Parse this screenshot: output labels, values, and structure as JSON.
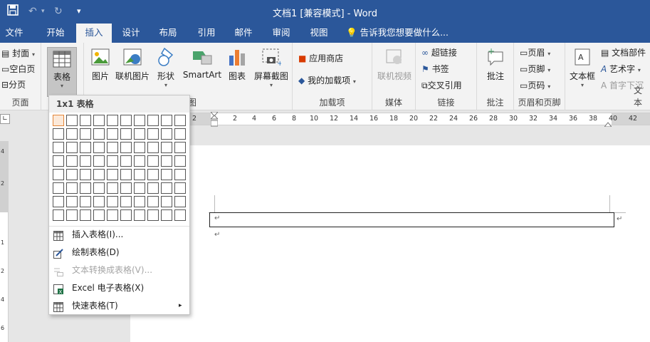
{
  "window": {
    "title": "文档1 [兼容模式] - Word"
  },
  "qat": {
    "save": "save-icon",
    "undo": "↶",
    "redo": "↻",
    "customize": "▾"
  },
  "tabs": [
    {
      "label": "文件"
    },
    {
      "label": "开始"
    },
    {
      "label": "插入",
      "active": true
    },
    {
      "label": "设计"
    },
    {
      "label": "布局"
    },
    {
      "label": "引用"
    },
    {
      "label": "邮件"
    },
    {
      "label": "审阅"
    },
    {
      "label": "视图"
    }
  ],
  "tell_me": "告诉我您想要做什么...",
  "ribbon": {
    "pages": {
      "cover": "封面",
      "blank": "空白页",
      "break": "分页",
      "label": "页面"
    },
    "table": {
      "label": "表格"
    },
    "illustrations": {
      "picture": "图片",
      "online_picture": "联机图片",
      "shapes": "形状",
      "smartart": "SmartArt",
      "chart": "图表",
      "screenshot": "屏幕截图",
      "group_tail": "图"
    },
    "addins": {
      "store": "应用商店",
      "my_addins": "我的加载项",
      "label": "加载项"
    },
    "media": {
      "online_video": "联机视频",
      "label": "媒体"
    },
    "links": {
      "hyperlink": "超链接",
      "bookmark": "书签",
      "crossref": "交叉引用",
      "label": "链接"
    },
    "comments": {
      "comment": "批注",
      "label": "批注"
    },
    "header_footer": {
      "header": "页眉",
      "footer": "页脚",
      "page_number": "页码",
      "label": "页眉和页脚"
    },
    "text": {
      "textbox": "文本框",
      "quick_parts": "文档部件",
      "wordart": "艺术字",
      "dropcap": "首字下沉",
      "label": "文本"
    }
  },
  "table_menu": {
    "header": "1x1 表格",
    "grid": {
      "cols": 10,
      "rows": 8,
      "selected_cols": 1,
      "selected_rows": 1
    },
    "items": [
      {
        "label": "插入表格(I)...",
        "icon": "table-icon",
        "enabled": true
      },
      {
        "label": "绘制表格(D)",
        "icon": "pencil-icon",
        "enabled": true
      },
      {
        "label": "文本转换成表格(V)...",
        "icon": "text-to-table-icon",
        "enabled": false
      },
      {
        "label": "Excel 电子表格(X)",
        "icon": "excel-icon",
        "enabled": true
      },
      {
        "label": "快速表格(T)",
        "icon": "table-icon",
        "enabled": true,
        "submenu": true
      }
    ]
  },
  "ruler": {
    "numbers": [
      "2",
      "2",
      "4",
      "6",
      "8",
      "10",
      "12",
      "14",
      "16",
      "18",
      "20",
      "22",
      "24",
      "26",
      "28",
      "30",
      "32",
      "34",
      "36",
      "38",
      "40",
      "42"
    ],
    "v_numbers": [
      "4",
      "2",
      "1",
      "2",
      "4",
      "6",
      "8"
    ]
  },
  "document": {
    "paragraph_mark": "↵"
  }
}
